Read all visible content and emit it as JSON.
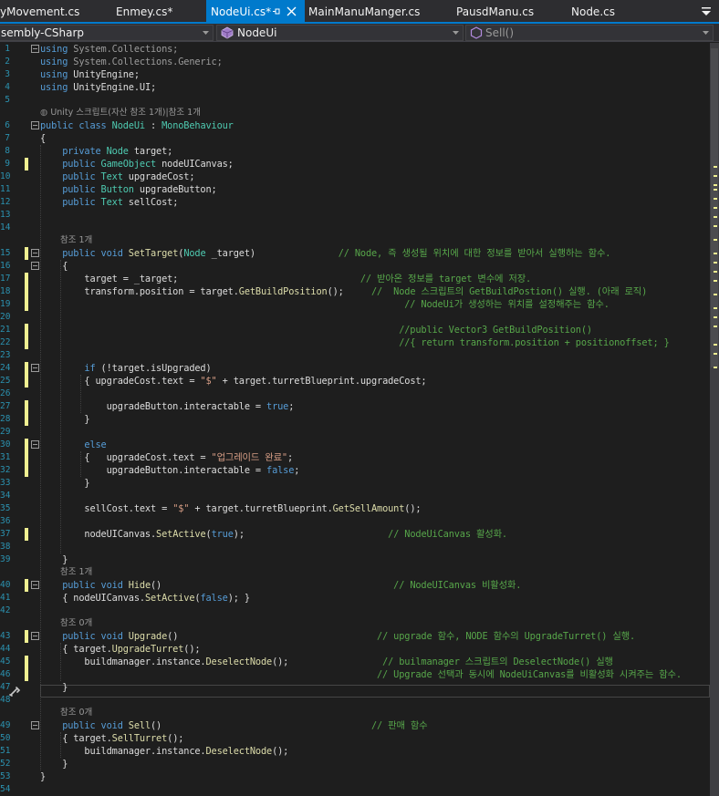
{
  "tabs": [
    {
      "label": "yMovement.cs",
      "active": false
    },
    {
      "label": "Enmey.cs*",
      "active": false
    },
    {
      "label": "NodeUi.cs*",
      "active": true
    },
    {
      "label": "MainManuManger.cs",
      "active": false
    },
    {
      "label": "PausdManu.cs",
      "active": false
    },
    {
      "label": "Node.cs",
      "active": false
    }
  ],
  "navbar": {
    "project": "sembly-CSharp",
    "class": "NodeUi",
    "member": "Sell()"
  },
  "colors": {
    "background": "#1e1e1e",
    "accent": "#007acc",
    "keyword": "#569cd6",
    "type": "#4ec9b0",
    "comment": "#57a64a",
    "string": "#d69d85",
    "line_number": "#2b91af",
    "change_marker": "#efef91"
  },
  "codelens": {
    "class_lens": "Unity 스크립트(자산 참조 1개)|참조 1개",
    "ref1": "참조 1개",
    "ref0": "참조 0개"
  },
  "lines": [
    {
      "n": "1",
      "parts": [
        [
          "k",
          "using"
        ],
        [
          "g",
          " System.Collections;"
        ]
      ]
    },
    {
      "n": "2",
      "parts": [
        [
          "k",
          "using"
        ],
        [
          "g",
          " System.Collections.Generic;"
        ]
      ]
    },
    {
      "n": "3",
      "parts": [
        [
          "k",
          "using"
        ],
        [
          "p",
          " UnityEngine;"
        ]
      ]
    },
    {
      "n": "4",
      "parts": [
        [
          "k",
          "using"
        ],
        [
          "p",
          " UnityEngine.UI;"
        ]
      ]
    },
    {
      "n": "5",
      "parts": []
    },
    {
      "n": "6",
      "parts": [
        [
          "k",
          "public class "
        ],
        [
          "t",
          "NodeUi"
        ],
        [
          "p",
          " : "
        ],
        [
          "t",
          "MonoBehaviour"
        ]
      ]
    },
    {
      "n": "7",
      "parts": [
        [
          "p",
          "{"
        ]
      ]
    },
    {
      "n": "8",
      "parts": [
        [
          "k",
          "    private "
        ],
        [
          "t",
          "Node"
        ],
        [
          "p",
          " target;"
        ]
      ]
    },
    {
      "n": "9",
      "parts": [
        [
          "k",
          "    public "
        ],
        [
          "t",
          "GameObject"
        ],
        [
          "p",
          " nodeUICanvas;"
        ]
      ]
    },
    {
      "n": "10",
      "parts": [
        [
          "k",
          "    public "
        ],
        [
          "t",
          "Text"
        ],
        [
          "p",
          " upgradeCost;"
        ]
      ]
    },
    {
      "n": "11",
      "parts": [
        [
          "k",
          "    public "
        ],
        [
          "t",
          "Button"
        ],
        [
          "p",
          " upgradeButton;"
        ]
      ]
    },
    {
      "n": "12",
      "parts": [
        [
          "k",
          "    public "
        ],
        [
          "t",
          "Text"
        ],
        [
          "p",
          " sellCost;"
        ]
      ]
    },
    {
      "n": "13",
      "parts": []
    },
    {
      "n": "14",
      "parts": []
    },
    {
      "n": "15",
      "parts": [
        [
          "k",
          "    public void "
        ],
        [
          "m",
          "SetTarget"
        ],
        [
          "p",
          "("
        ],
        [
          "t",
          "Node"
        ],
        [
          "p",
          " _target)"
        ],
        [
          "c",
          "               // Node, 즉 생성될 위치에 대한 정보를 받아서 실행하는 함수."
        ]
      ]
    },
    {
      "n": "16",
      "parts": [
        [
          "p",
          "    {"
        ]
      ]
    },
    {
      "n": "17",
      "parts": [
        [
          "p",
          "        target = _target;"
        ],
        [
          "c",
          "                                 // 받아온 정보를 target 변수에 저장."
        ]
      ]
    },
    {
      "n": "18",
      "parts": [
        [
          "p",
          "        transform.position = target."
        ],
        [
          "m",
          "GetBuildPosition"
        ],
        [
          "p",
          "();"
        ],
        [
          "c",
          "     //  Node 스크립트의 GetBuildPostion() 실행. (아래 로직)"
        ]
      ]
    },
    {
      "n": "19",
      "parts": [
        [
          "c",
          "                                                                  // NodeUi가 생성하는 위치를 설정해주는 함수."
        ]
      ]
    },
    {
      "n": "20",
      "parts": []
    },
    {
      "n": "21",
      "parts": [
        [
          "c",
          "                                                                 //public Vector3 GetBuildPosition()"
        ]
      ]
    },
    {
      "n": "22",
      "parts": [
        [
          "c",
          "                                                                 //{ return transform.position + positionoffset; }"
        ]
      ]
    },
    {
      "n": "23",
      "parts": []
    },
    {
      "n": "24",
      "parts": [
        [
          "k",
          "        if"
        ],
        [
          "p",
          " (!target.isUpgraded)"
        ]
      ]
    },
    {
      "n": "25",
      "parts": [
        [
          "p",
          "        { upgradeCost.text = "
        ],
        [
          "s",
          "\"$\""
        ],
        [
          "p",
          " + target.turretBlueprint.upgradeCost;"
        ]
      ]
    },
    {
      "n": "26",
      "parts": []
    },
    {
      "n": "27",
      "parts": [
        [
          "p",
          "            upgradeButton.interactable = "
        ],
        [
          "k",
          "true"
        ],
        [
          "p",
          ";"
        ]
      ]
    },
    {
      "n": "28",
      "parts": [
        [
          "p",
          "        }"
        ]
      ]
    },
    {
      "n": "29",
      "parts": []
    },
    {
      "n": "30",
      "parts": [
        [
          "k",
          "        else"
        ]
      ]
    },
    {
      "n": "31",
      "parts": [
        [
          "p",
          "        {   upgradeCost.text = "
        ],
        [
          "s",
          "\"업그레이드 완료\""
        ],
        [
          "p",
          ";"
        ]
      ]
    },
    {
      "n": "32",
      "parts": [
        [
          "p",
          "            upgradeButton.interactable = "
        ],
        [
          "k",
          "false"
        ],
        [
          "p",
          ";"
        ]
      ]
    },
    {
      "n": "33",
      "parts": [
        [
          "p",
          "        }"
        ]
      ]
    },
    {
      "n": "34",
      "parts": []
    },
    {
      "n": "35",
      "parts": [
        [
          "p",
          "        sellCost.text = "
        ],
        [
          "s",
          "\"$\""
        ],
        [
          "p",
          " + target.turretBlueprint."
        ],
        [
          "m",
          "GetSellAmount"
        ],
        [
          "p",
          "();"
        ]
      ]
    },
    {
      "n": "36",
      "parts": []
    },
    {
      "n": "37",
      "parts": [
        [
          "p",
          "        nodeUICanvas."
        ],
        [
          "m",
          "SetActive"
        ],
        [
          "p",
          "("
        ],
        [
          "k",
          "true"
        ],
        [
          "p",
          ");"
        ],
        [
          "c",
          "                          // NodeUiCanvas 활성화."
        ]
      ]
    },
    {
      "n": "38",
      "parts": []
    },
    {
      "n": "39",
      "parts": [
        [
          "p",
          "    }"
        ]
      ]
    },
    {
      "n": "40",
      "parts": [
        [
          "k",
          "    public void "
        ],
        [
          "m",
          "Hide"
        ],
        [
          "p",
          "()"
        ],
        [
          "c",
          "                                          // NodeUICanvas 비활성화."
        ]
      ]
    },
    {
      "n": "41",
      "parts": [
        [
          "p",
          "    { nodeUICanvas."
        ],
        [
          "m",
          "SetActive"
        ],
        [
          "p",
          "("
        ],
        [
          "k",
          "false"
        ],
        [
          "p",
          "); }"
        ]
      ]
    },
    {
      "n": "42",
      "parts": []
    },
    {
      "n": "43",
      "parts": [
        [
          "k",
          "    public void "
        ],
        [
          "m",
          "Upgrade"
        ],
        [
          "p",
          "()"
        ],
        [
          "c",
          "                                    // upgrade 함수, NODE 함수의 UpgradeTurret() 실행."
        ]
      ]
    },
    {
      "n": "44",
      "parts": [
        [
          "p",
          "    { target."
        ],
        [
          "m",
          "UpgradeTurret"
        ],
        [
          "p",
          "();"
        ]
      ]
    },
    {
      "n": "45",
      "parts": [
        [
          "p",
          "        buildmanager.instance."
        ],
        [
          "m",
          "DeselectNode"
        ],
        [
          "p",
          "();"
        ],
        [
          "c",
          "                 // builmanager 스크립트의 DeselectNode() 실행"
        ]
      ]
    },
    {
      "n": "46",
      "parts": [
        [
          "c",
          "                                                             // Upgrade 선택과 동시에 NodeUiCanvas를 비활성화 시켜주는 함수."
        ]
      ]
    },
    {
      "n": "47",
      "parts": [
        [
          "p",
          "    }"
        ]
      ]
    },
    {
      "n": "48",
      "parts": []
    },
    {
      "n": "49",
      "parts": [
        [
          "k",
          "    public void "
        ],
        [
          "m",
          "Sell"
        ],
        [
          "p",
          "()"
        ],
        [
          "c",
          "                                      // 판매 함수"
        ]
      ]
    },
    {
      "n": "50",
      "parts": [
        [
          "p",
          "    { target."
        ],
        [
          "m",
          "SellTurret"
        ],
        [
          "p",
          "();"
        ]
      ]
    },
    {
      "n": "51",
      "parts": [
        [
          "p",
          "        buildmanager.instance."
        ],
        [
          "m",
          "DeselectNode"
        ],
        [
          "p",
          "();"
        ]
      ]
    },
    {
      "n": "52",
      "parts": [
        [
          "p",
          "    }"
        ]
      ]
    },
    {
      "n": "53",
      "parts": [
        [
          "p",
          "}"
        ]
      ]
    },
    {
      "n": "54",
      "parts": []
    }
  ]
}
